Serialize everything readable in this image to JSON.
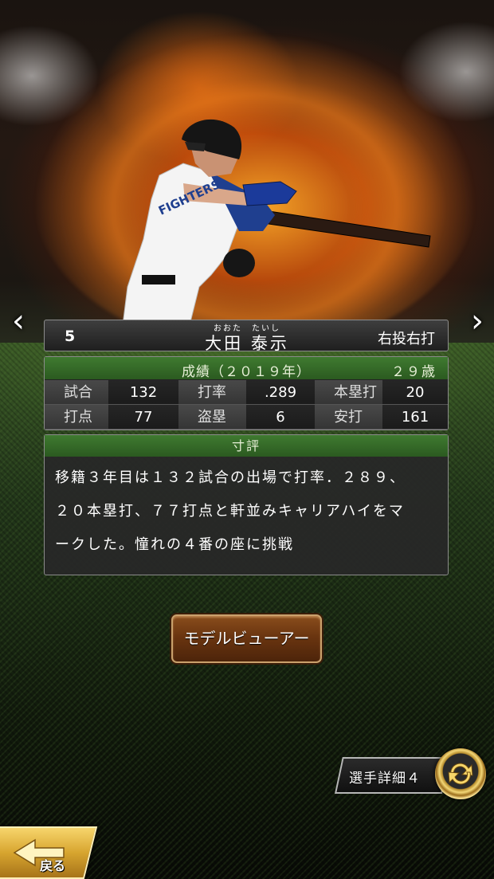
{
  "player": {
    "number": "5",
    "name_ruby": "おおた　たいし",
    "name": "大田 泰示",
    "bat_throw": "右投右打",
    "jersey_text": "FIGHTERS"
  },
  "stats": {
    "title": "成績（２０１９年）",
    "age": "２９歳",
    "rows": [
      [
        {
          "label": "試合",
          "value": "132"
        },
        {
          "label": "打率",
          "value": ".289"
        },
        {
          "label": "本塁打",
          "value": "20"
        }
      ],
      [
        {
          "label": "打点",
          "value": "77"
        },
        {
          "label": "盗塁",
          "value": "6"
        },
        {
          "label": "安打",
          "value": "161"
        }
      ]
    ]
  },
  "review": {
    "title": "寸評",
    "lines": [
      "移籍３年目は１３２試合の出場で打率．２８９、",
      "２０本塁打、７７打点と軒並みキャリアハイをマ",
      "ークした。憧れの４番の座に挑戦"
    ]
  },
  "buttons": {
    "model_viewer": "モデルビューアー",
    "player_detail": "選手詳細４",
    "back": "戻る"
  },
  "icons": {
    "prev": "‹",
    "next": "›"
  }
}
